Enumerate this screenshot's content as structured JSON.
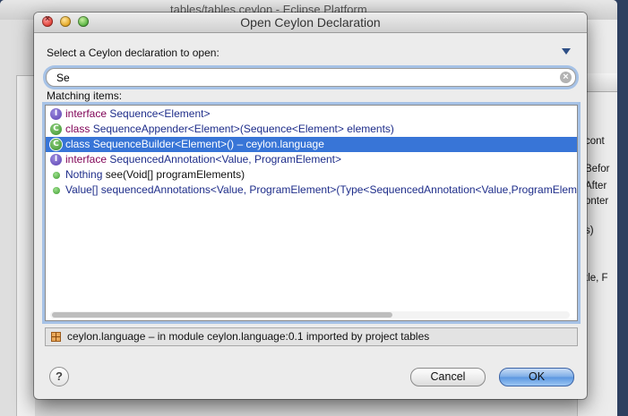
{
  "background_window": {
    "title": "tables/tables.ceylon - Eclipse Platform",
    "right_snippets": [
      "cont",
      "Befor",
      "After",
      "onter",
      "s)",
      "tle, F"
    ]
  },
  "dialog": {
    "title": "Open Ceylon Declaration",
    "prompt": "Select a Ceylon declaration to open:",
    "search": {
      "value": "Se",
      "placeholder": ""
    },
    "matching_label": "Matching items:",
    "items": [
      {
        "icon": "interface-icon",
        "keyword": "interface",
        "name": "Sequence",
        "rest": "<Element>",
        "selected": false
      },
      {
        "icon": "class-icon",
        "keyword": "class",
        "name": "SequenceAppender",
        "rest": "<Element>(Sequence<Element> elements)",
        "selected": false
      },
      {
        "icon": "class-icon",
        "keyword": "class",
        "name": "SequenceBuilder",
        "rest": "<Element>() – ceylon.language",
        "selected": true
      },
      {
        "icon": "interface-icon",
        "keyword": "interface",
        "name": "SequencedAnnotation",
        "rest": "<Value, ProgramElement>",
        "selected": false
      },
      {
        "icon": "method-icon",
        "keyword": "Nothing",
        "name": "",
        "rest": " see(Void[] programElements)",
        "selected": false
      },
      {
        "icon": "method-icon",
        "keyword": "Value[]",
        "name": "",
        "rest": " sequencedAnnotations<Value, ProgramElement>(Type<SequencedAnnotation<Value,ProgramElem",
        "selected": false
      }
    ],
    "status": "ceylon.language –  in module ceylon.language:0.1 imported by project tables",
    "buttons": {
      "help": "?",
      "cancel": "Cancel",
      "ok": "OK"
    }
  },
  "colors": {
    "selection": "#3875d7",
    "keyword": "#7f0055",
    "type_name": "#1e2d8a",
    "focus_ring": "#6da0e1"
  }
}
